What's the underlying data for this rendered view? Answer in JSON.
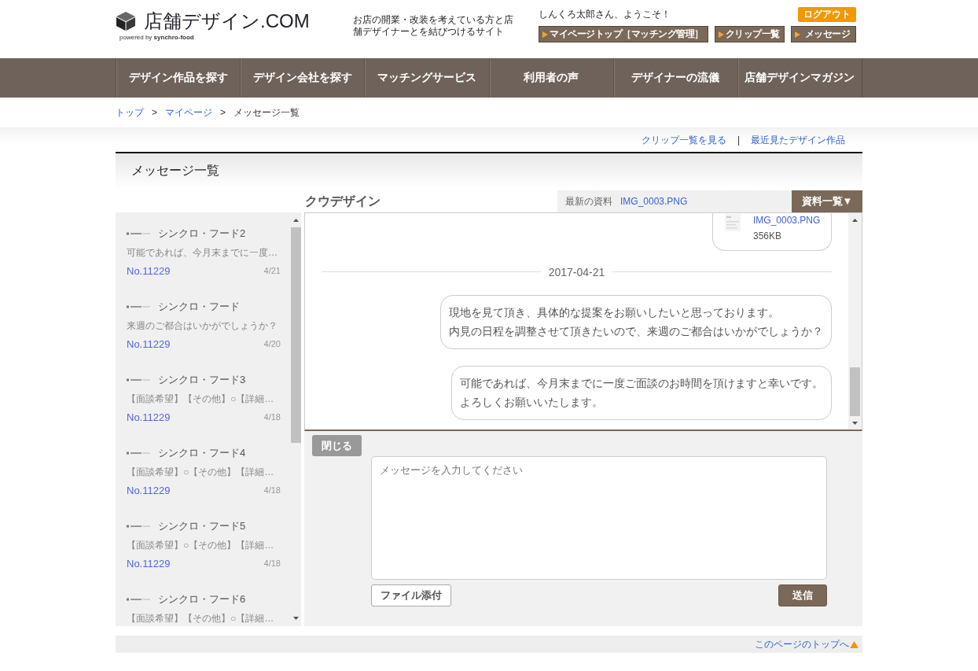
{
  "header": {
    "logo": {
      "title": "店舗デザイン.COM",
      "powered_by": "powered by **synchro-food**"
    },
    "tagline": "お店の開業・改装を考えている方と店舗デザイナーとを結びつけるサイト",
    "greeting": "しんくろ太郎さん、ようこそ！",
    "logout": "ログアウト",
    "buttons": [
      "マイページトップ［マッチング管理］",
      "クリップ一覧",
      "メッセージ"
    ]
  },
  "nav": [
    "デザイン作品を探す",
    "デザイン会社を探す",
    "マッチングサービス",
    "利用者の声",
    "デザイナーの流儀",
    "店舗デザインマガジン"
  ],
  "breadcrumb": [
    {
      "kind": "link",
      "text": "トップ"
    },
    {
      "kind": "separator",
      "text": ">"
    },
    {
      "kind": "link",
      "text": "マイページ"
    },
    {
      "kind": "separator",
      "text": ">"
    },
    {
      "kind": "current",
      "text": "メッセージ一覧"
    }
  ],
  "sub_links": [
    {
      "kind": "link",
      "text": "クリップ一覧を見る"
    },
    {
      "kind": "separator",
      "text": "|"
    },
    {
      "kind": "link",
      "text": "最近見たデザイン作品"
    }
  ],
  "page_title": "メッセージ一覧",
  "conversation": {
    "partner": "クウデザイン",
    "latest_file_label": "最新の資料",
    "latest_file": "IMG_0003.PNG",
    "files_button": "資料一覧▼"
  },
  "threads": [
    {
      "name": "シンクロ・フード2",
      "preview": "可能であれば、今月末までに一度…",
      "number": "No.11229",
      "date": "4/21"
    },
    {
      "name": "シンクロ・フード",
      "preview": "来週のご都合はいかがでしょうか？",
      "number": "No.11229",
      "date": "4/20"
    },
    {
      "name": "シンクロ・フード3",
      "preview": "【面談希望】【その他】○【詳細…",
      "number": "No.11229",
      "date": "4/18"
    },
    {
      "name": "シンクロ・フード4",
      "preview": "【面談希望】○【その他】【詳細…",
      "number": "No.11229",
      "date": "4/18"
    },
    {
      "name": "シンクロ・フード5",
      "preview": "【面談希望】○【その他】【詳細…",
      "number": "No.11229",
      "date": "4/18"
    },
    {
      "name": "シンクロ・フード6",
      "preview": "【面談希望】【その他】○【詳細…"
    }
  ],
  "messages": [
    {
      "kind": "file",
      "file_name": "IMG_0003.PNG",
      "size": "356KB"
    },
    {
      "kind": "date",
      "text": "2017-04-21"
    },
    {
      "kind": "text",
      "lines": [
        "現地を見て頂き、具体的な提案をお願いしたいと思っております。",
        "内見の日程を調整させて頂きたいので、来週のご都合はいかがでしょうか？"
      ]
    },
    {
      "kind": "text",
      "lines": [
        "可能であれば、今月末までに一度ご面談のお時間を頂けますと幸いです。",
        "よろしくお願いいたします。"
      ]
    }
  ],
  "composer": {
    "close": "閉じる",
    "placeholder": "メッセージを入力してください",
    "attach": "ファイル添付",
    "send": "送信"
  },
  "footer": {
    "back_to_top": "このページのトップへ"
  }
}
